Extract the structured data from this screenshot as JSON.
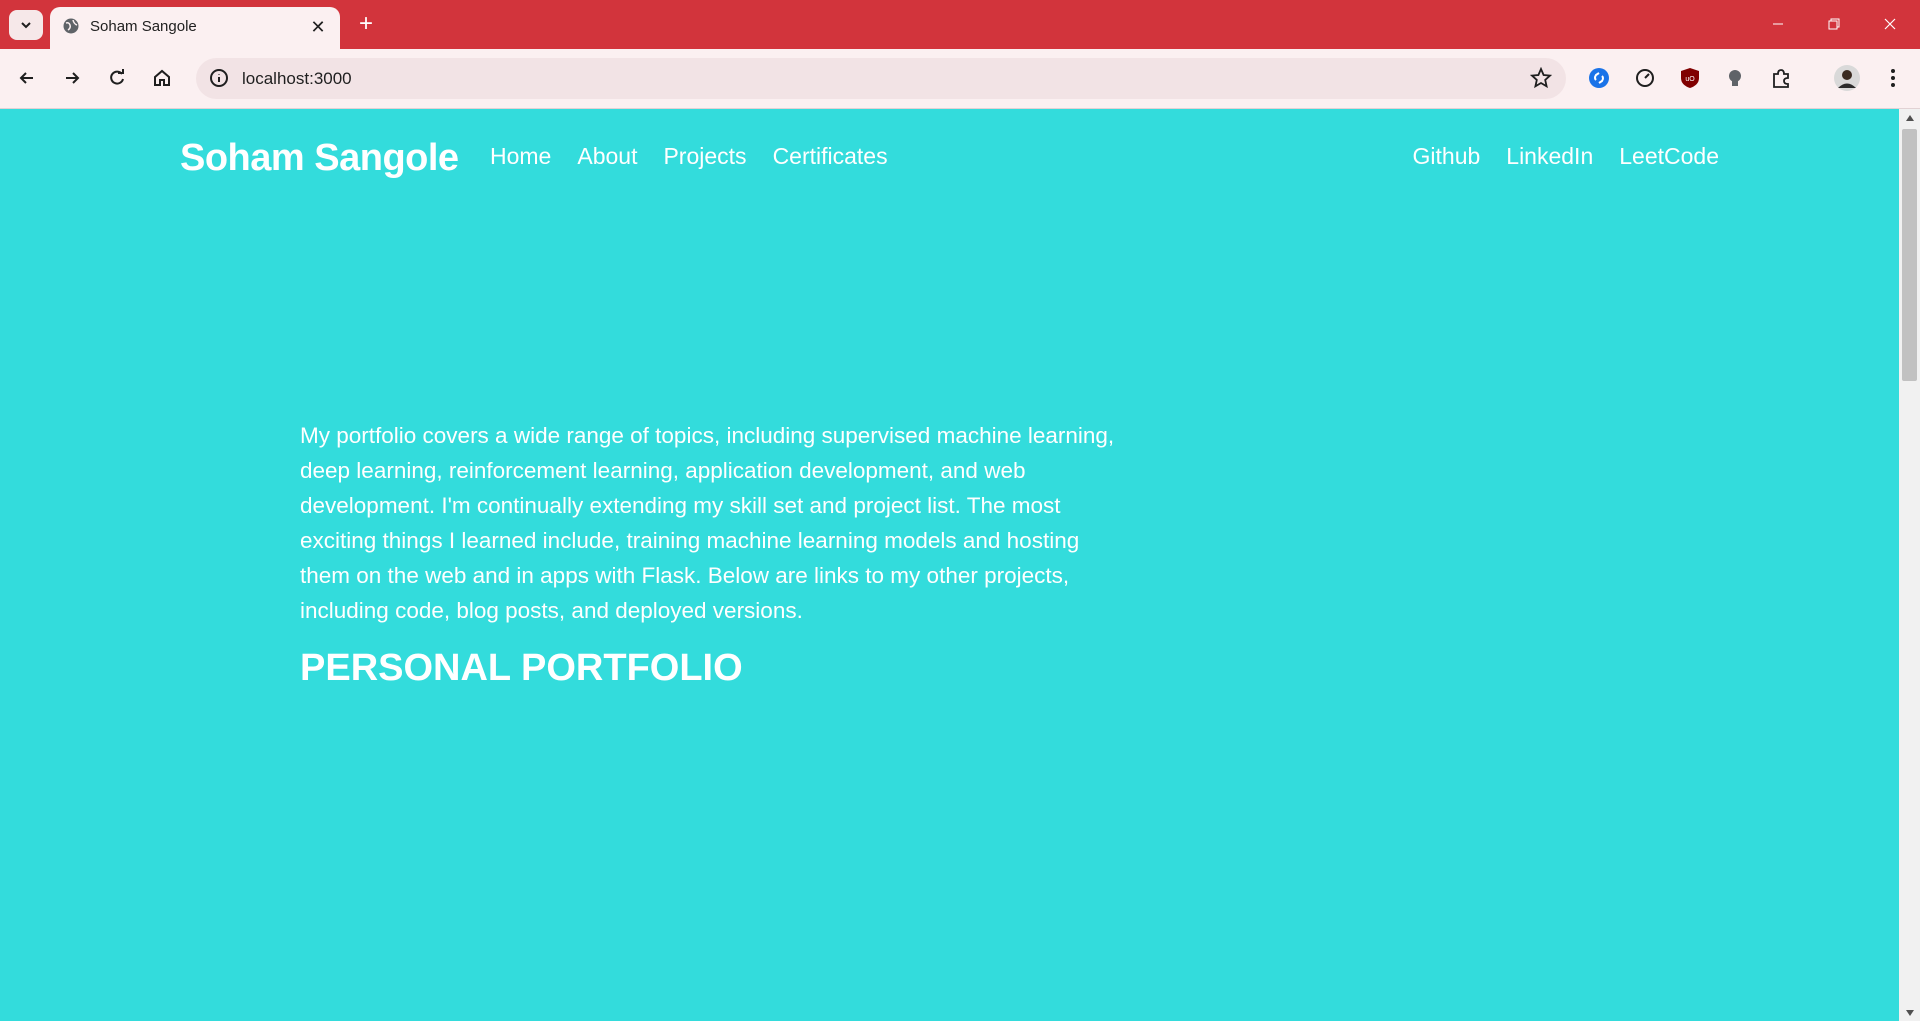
{
  "browser": {
    "tab_title": "Soham Sangole",
    "url": "localhost:3000",
    "accent_color": "#d2343c"
  },
  "site": {
    "brand": "Soham Sangole",
    "nav": [
      "Home",
      "About",
      "Projects",
      "Certificates"
    ],
    "social": [
      "Github",
      "LinkedIn",
      "LeetCode"
    ],
    "hero_text": "My portfolio covers a wide range of topics, including supervised machine learning, deep learning, reinforcement learning, application development, and web development. I'm continually extending my skill set and project list. The most exciting things I learned include, training machine learning models and hosting them on the web and in apps with Flask. Below are links to my other projects, including code, blog posts, and deployed versions.",
    "hero_title": "PERSONAL PORTFOLIO",
    "background_color": "#33dcdc"
  }
}
